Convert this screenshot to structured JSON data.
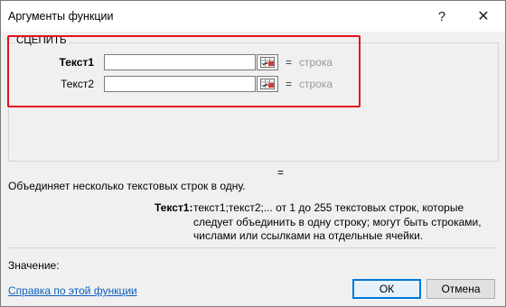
{
  "window": {
    "title": "Аргументы функции",
    "help_glyph": "?",
    "close_glyph": "✕"
  },
  "function_group": {
    "name": "СЦЕПИТЬ",
    "args": [
      {
        "label": "Текст1",
        "value": "",
        "equals": "=",
        "type_hint": "строка",
        "bold": true
      },
      {
        "label": "Текст2",
        "value": "",
        "equals": "=",
        "type_hint": "строка",
        "bold": false
      }
    ]
  },
  "result_equals": "=",
  "description": "Объединяет несколько текстовых строк в одну.",
  "arg_description": {
    "label": "Текст1:",
    "text": "текст1;текст2;... от 1 до 255 текстовых строк, которые следует объединить в одну строку; могут быть строками, числами или ссылками на отдельные ячейки."
  },
  "value_label": "Значение:",
  "help_link": "Справка по этой функции",
  "buttons": {
    "ok": "ОК",
    "cancel": "Отмена"
  },
  "colors": {
    "highlight": "#e8101a",
    "link": "#0a60c2",
    "hint": "#9a9a9a"
  },
  "icons": {
    "ref_button": "collapse-dialog-icon"
  }
}
